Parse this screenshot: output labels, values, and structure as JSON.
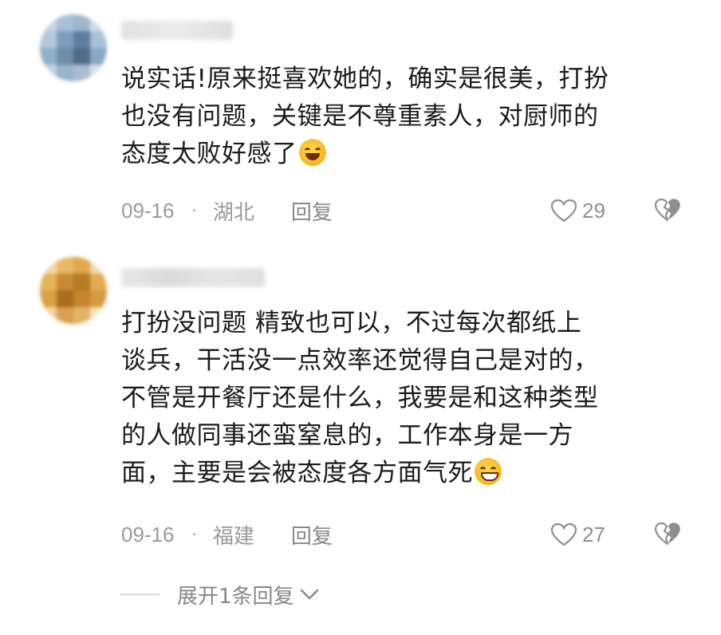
{
  "comments": [
    {
      "username": "",
      "text_lines": [
        "说实话!原来挺喜欢她的，确实是很美，打扮",
        "也没有问题，关键是不尊重素人，对厨师的",
        "态度太败好感了"
      ],
      "emoji": "rofl-emoji",
      "date": "09-16",
      "separator": "·",
      "location": "湖北",
      "reply_label": "回复",
      "likes": "29"
    },
    {
      "username": "",
      "text_lines": [
        "打扮没问题 精致也可以，不过每次都纸上",
        "谈兵，干活没一点效率还觉得自己是对的，",
        "不管是开餐厅还是什么，我要是和这种类型",
        "的人做同事还蛮窒息的，工作本身是一方",
        "面，主要是会被态度各方面气死"
      ],
      "emoji": "grin-sweat-emoji",
      "date": "09-16",
      "separator": "·",
      "location": "福建",
      "reply_label": "回复",
      "likes": "27"
    }
  ],
  "expand_replies_label": "展开1条回复",
  "colors": {
    "meta_gray": "#9a9a9a",
    "text": "#1b1b1b",
    "emoji_yellow": "#f7b21a"
  }
}
